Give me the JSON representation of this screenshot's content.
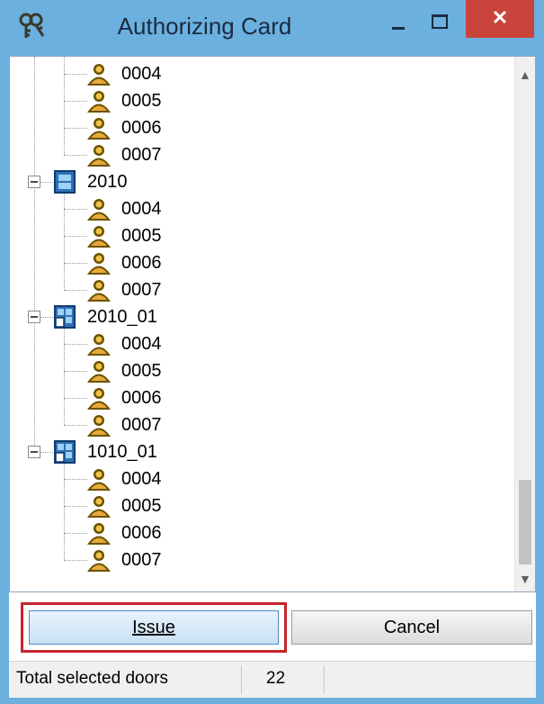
{
  "window": {
    "title": "Authorizing Card",
    "close_symbol": "✕",
    "icon": "keys-icon"
  },
  "tree": {
    "groups": [
      {
        "label": "",
        "users": [
          "0004",
          "0005",
          "0006",
          "0007"
        ],
        "icon": "reader-icon"
      },
      {
        "label": "2010",
        "users": [
          "0004",
          "0005",
          "0006",
          "0007"
        ],
        "icon": "door-icon"
      },
      {
        "label": "2010_01",
        "users": [
          "0004",
          "0005",
          "0006",
          "0007"
        ],
        "icon": "door-grid-icon"
      },
      {
        "label": "1010_01",
        "users": [
          "0004",
          "0005",
          "0006",
          "0007"
        ],
        "icon": "door-grid-icon"
      }
    ]
  },
  "buttons": {
    "issue_label": "Issue",
    "cancel_label": "Cancel"
  },
  "status": {
    "label": "Total selected doors",
    "count": "22"
  },
  "colors": {
    "title_bar": "#6bb0df",
    "close_button": "#c9443a",
    "highlight_outline": "#c8232c"
  }
}
